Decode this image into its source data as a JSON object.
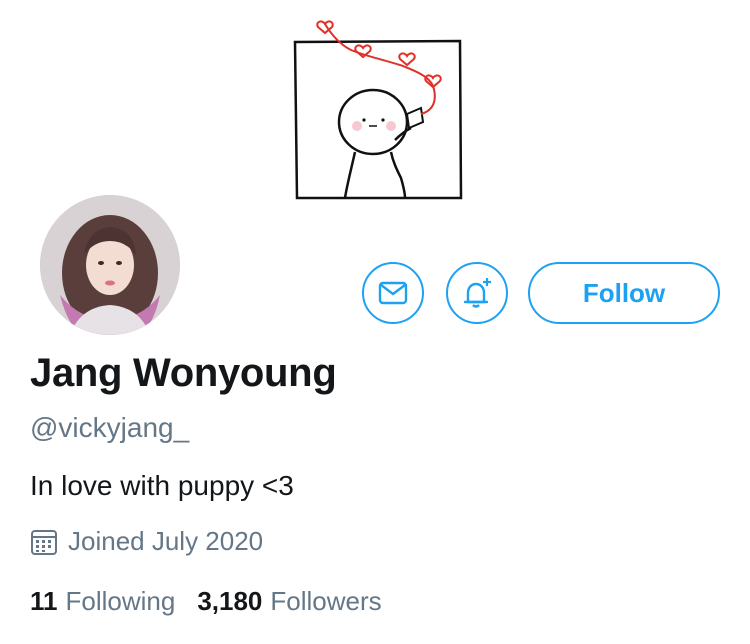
{
  "profile": {
    "name": "Jang Wonyoung",
    "handle": "@vickyjang_",
    "bio": "In love with puppy <3",
    "joined": "Joined July 2020"
  },
  "stats": {
    "following_count": "11",
    "following_label": "Following",
    "followers_count": "3,180",
    "followers_label": "Followers"
  },
  "actions": {
    "follow_label": "Follow",
    "message_icon": "envelope-icon",
    "notify_icon": "bell-plus-icon"
  },
  "colors": {
    "accent": "#1da1f2",
    "text": "#14171a",
    "secondary": "#657786",
    "heart": "#e0302a"
  },
  "icons": {
    "banner": "doodle-character-phone-hearts",
    "joined": "calendar-icon"
  }
}
